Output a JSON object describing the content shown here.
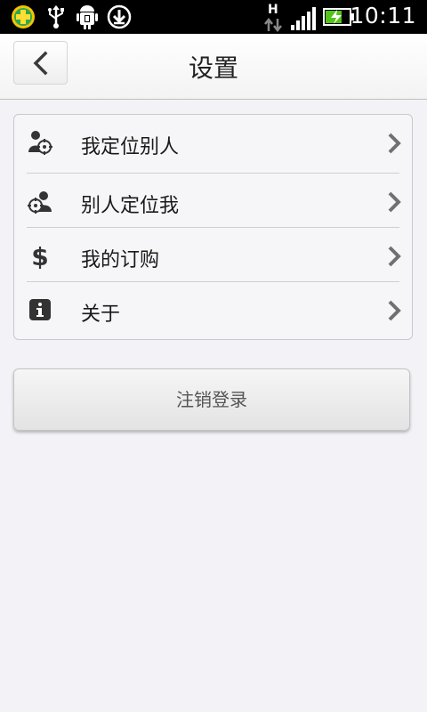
{
  "status_bar": {
    "time": "10:11",
    "network_type": "H",
    "icons": [
      "app-notification-icon",
      "usb-icon",
      "android-debug-icon",
      "download-icon",
      "data-transfer-icon",
      "signal-icon",
      "battery-charging-icon"
    ]
  },
  "header": {
    "title": "设置",
    "back_icon": "chevron-left-icon"
  },
  "settings": {
    "items": [
      {
        "label": "我定位别人",
        "icon": "locate-others-icon"
      },
      {
        "label": "别人定位我",
        "icon": "located-by-others-icon"
      },
      {
        "label": "我的订购",
        "icon": "dollar-icon"
      },
      {
        "label": "关于",
        "icon": "info-icon"
      }
    ]
  },
  "logout": {
    "label": "注销登录"
  },
  "colors": {
    "background": "#f2f2f7",
    "status_bar": "#000000",
    "battery_green": "#52c41a",
    "icon_dark": "#333333",
    "chevron": "#707070"
  }
}
